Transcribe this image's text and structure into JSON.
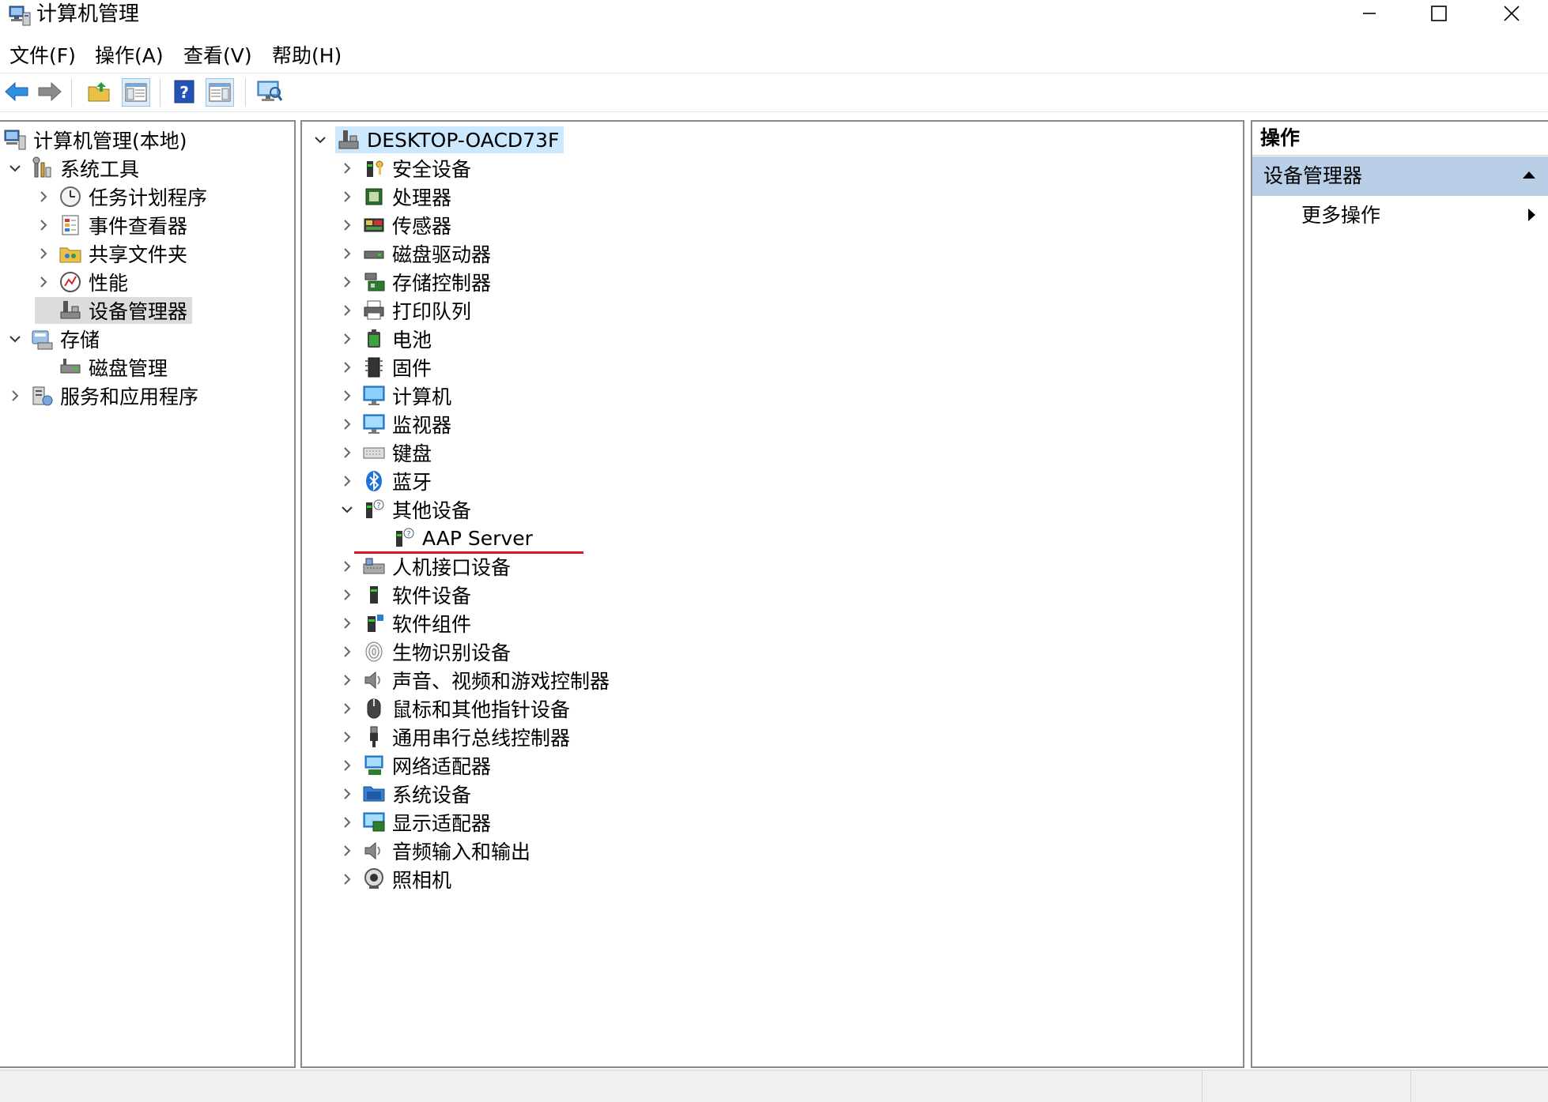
{
  "window": {
    "title": "计算机管理"
  },
  "menu": [
    "文件(F)",
    "操作(A)",
    "查看(V)",
    "帮助(H)"
  ],
  "left_tree": [
    {
      "label": "计算机管理(本地)",
      "icon": "computer-management-icon",
      "level": 0,
      "chevron": "none"
    },
    {
      "label": "系统工具",
      "icon": "system-tools-icon",
      "level": 1,
      "chevron": "down"
    },
    {
      "label": "任务计划程序",
      "icon": "clock-icon",
      "level": 2,
      "chevron": "right"
    },
    {
      "label": "事件查看器",
      "icon": "event-viewer-icon",
      "level": 2,
      "chevron": "right"
    },
    {
      "label": "共享文件夹",
      "icon": "shared-folder-icon",
      "level": 2,
      "chevron": "right"
    },
    {
      "label": "性能",
      "icon": "performance-icon",
      "level": 2,
      "chevron": "right"
    },
    {
      "label": "设备管理器",
      "icon": "device-manager-icon",
      "level": 2,
      "chevron": "none",
      "selected": true
    },
    {
      "label": "存储",
      "icon": "storage-icon",
      "level": 1,
      "chevron": "down"
    },
    {
      "label": "磁盘管理",
      "icon": "disk-management-icon",
      "level": 2,
      "chevron": "none"
    },
    {
      "label": "服务和应用程序",
      "icon": "services-icon",
      "level": 1,
      "chevron": "right"
    }
  ],
  "device_tree": {
    "root": "DESKTOP-OACD73F",
    "items": [
      {
        "label": "安全设备",
        "icon": "security-device-icon",
        "chevron": "right"
      },
      {
        "label": "处理器",
        "icon": "processor-icon",
        "chevron": "right"
      },
      {
        "label": "传感器",
        "icon": "sensor-icon",
        "chevron": "right"
      },
      {
        "label": "磁盘驱动器",
        "icon": "disk-drive-icon",
        "chevron": "right"
      },
      {
        "label": "存储控制器",
        "icon": "storage-controller-icon",
        "chevron": "right"
      },
      {
        "label": "打印队列",
        "icon": "printer-icon",
        "chevron": "right"
      },
      {
        "label": "电池",
        "icon": "battery-icon",
        "chevron": "right"
      },
      {
        "label": "固件",
        "icon": "firmware-icon",
        "chevron": "right"
      },
      {
        "label": "计算机",
        "icon": "computer-icon",
        "chevron": "right"
      },
      {
        "label": "监视器",
        "icon": "monitor-icon",
        "chevron": "right"
      },
      {
        "label": "键盘",
        "icon": "keyboard-icon",
        "chevron": "right"
      },
      {
        "label": "蓝牙",
        "icon": "bluetooth-icon",
        "chevron": "right"
      },
      {
        "label": "其他设备",
        "icon": "unknown-device-icon",
        "chevron": "down"
      },
      {
        "label": "AAP Server",
        "icon": "unknown-device-icon",
        "chevron": "none",
        "child": true,
        "underlined": true
      },
      {
        "label": "人机接口设备",
        "icon": "hid-icon",
        "chevron": "right"
      },
      {
        "label": "软件设备",
        "icon": "software-device-icon",
        "chevron": "right"
      },
      {
        "label": "软件组件",
        "icon": "software-component-icon",
        "chevron": "right"
      },
      {
        "label": "生物识别设备",
        "icon": "fingerprint-icon",
        "chevron": "right"
      },
      {
        "label": "声音、视频和游戏控制器",
        "icon": "speaker-icon",
        "chevron": "right"
      },
      {
        "label": "鼠标和其他指针设备",
        "icon": "mouse-icon",
        "chevron": "right"
      },
      {
        "label": "通用串行总线控制器",
        "icon": "usb-icon",
        "chevron": "right"
      },
      {
        "label": "网络适配器",
        "icon": "network-adapter-icon",
        "chevron": "right"
      },
      {
        "label": "系统设备",
        "icon": "system-device-icon",
        "chevron": "right"
      },
      {
        "label": "显示适配器",
        "icon": "display-adapter-icon",
        "chevron": "right"
      },
      {
        "label": "音频输入和输出",
        "icon": "audio-io-icon",
        "chevron": "right"
      },
      {
        "label": "照相机",
        "icon": "camera-icon",
        "chevron": "right"
      }
    ]
  },
  "actions": {
    "header": "操作",
    "section": "设备管理器",
    "more": "更多操作"
  },
  "colors": {
    "selected_left": "#dcdcdc",
    "root_highlight": "#cce8ff",
    "actions_section": "#b9cfe8",
    "underline": "#e81123"
  }
}
